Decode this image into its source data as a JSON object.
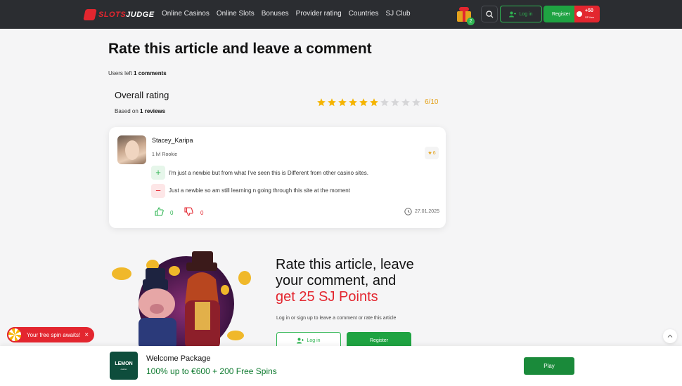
{
  "header": {
    "logo_part1": "SLOTS",
    "logo_part2": "JUDGE",
    "nav": [
      "Online Casinos",
      "Online Slots",
      "Bonuses",
      "Provider rating",
      "Countries",
      "SJ Club"
    ],
    "gift_count": "2",
    "login_label": "Log in",
    "register_label": "Register",
    "bonus_value": "+50",
    "bonus_sub": "SP free"
  },
  "article": {
    "title": "Rate this article and leave a comment",
    "users_left_prefix": "Users left",
    "users_left_value": "1 comments",
    "overall_label": "Overall rating",
    "based_prefix": "Based on",
    "based_value": "1 reviews",
    "rating": 6,
    "rating_max": 10,
    "score_text": "6/10"
  },
  "review": {
    "username": "Stacey_Karipa",
    "level": "1 lvl Rookie",
    "user_rating": "6",
    "pro": "I'm just a newbie but from what I've seen this is Different from other casino sites.",
    "con": "Just a newbie so am still learning n going through this site at the moment",
    "likes": "0",
    "dislikes": "0",
    "date": "27.01.2025"
  },
  "promo": {
    "line1": "Rate this article, leave",
    "line2": "your comment, and",
    "line3": "get 25 SJ Points",
    "subtitle": "Log in or sign up to leave a comment or rate this article",
    "login_label": "Log in",
    "register_label": "Register"
  },
  "freespin": {
    "text": "Your free spin awaits!",
    "close": "×"
  },
  "bottom_bar": {
    "casino_name": "LEMON",
    "casino_sub": "casino",
    "title": "Welcome Package",
    "offer": "100% up to €600 + 200 Free Spins",
    "play_label": "Play"
  },
  "colors": {
    "accent_red": "#e3262f",
    "accent_green": "#1fa342",
    "star_gold": "#f5b400",
    "header_bg": "#2b2d31"
  }
}
